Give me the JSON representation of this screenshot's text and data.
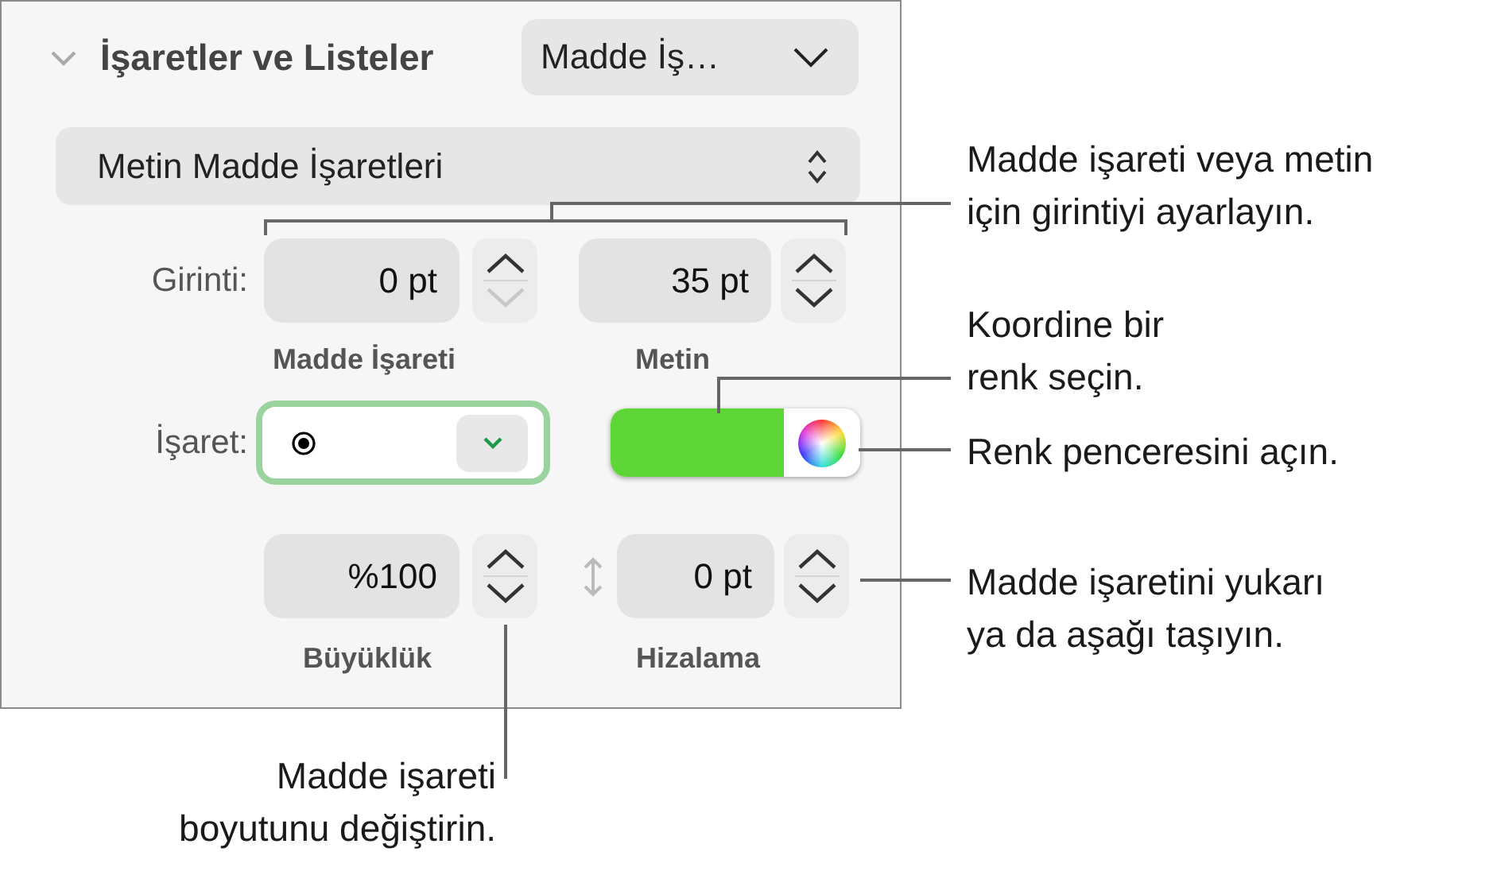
{
  "panel": {
    "title": "İşaretler ve Listeler",
    "expanded": true,
    "style_popup": "Madde İş…",
    "bullet_type": "Metin Madde İşaretleri",
    "indent": {
      "label": "Girinti:",
      "fields": [
        {
          "value": "0 pt",
          "caption": "Madde İşareti",
          "down_disabled": true
        },
        {
          "value": "35 pt",
          "caption": "Metin",
          "down_disabled": false
        }
      ]
    },
    "bullet": {
      "label": "İşaret:",
      "focused": true,
      "color": "#5fd637"
    },
    "size": {
      "value": "%100",
      "caption": "Büyüklük"
    },
    "align": {
      "value": "0 pt",
      "caption": "Hizalama"
    }
  },
  "callouts": [
    {
      "text": "Madde işareti veya metin\niçin girintiyi ayarlayın."
    },
    {
      "text": "Koordine bir\nrenk seçin."
    },
    {
      "text": "Renk penceresini açın."
    },
    {
      "text": "Madde işaretini yukarı\nya da aşağı taşıyın."
    },
    {
      "text": "Madde işareti\nboyutunu değiştirin."
    }
  ]
}
